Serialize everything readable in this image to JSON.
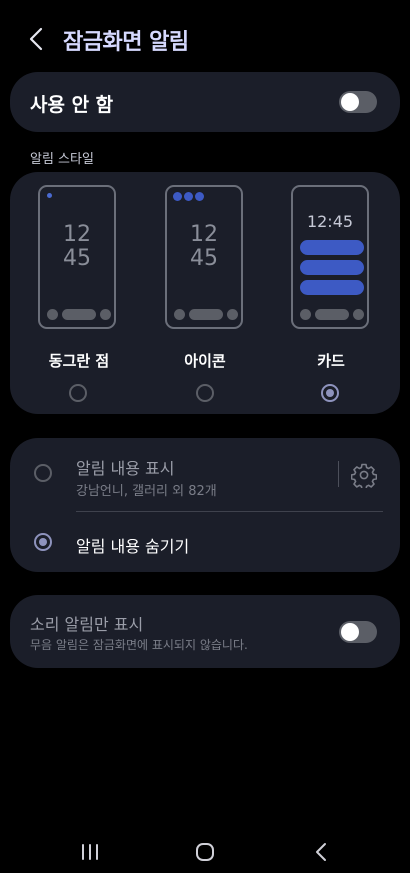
{
  "header": {
    "title": "잠금화면 알림",
    "back_icon": "back-chevron-icon"
  },
  "master_toggle": {
    "label": "사용 안 함",
    "on": false
  },
  "style_section": {
    "label": "알림 스타일",
    "options": [
      {
        "label": "동그란 점",
        "clock": [
          "12",
          "45"
        ],
        "selected": false
      },
      {
        "label": "아이콘",
        "clock": [
          "12",
          "45"
        ],
        "selected": false
      },
      {
        "label": "카드",
        "clock": "12:45",
        "selected": true
      }
    ]
  },
  "visibility": {
    "show": {
      "title": "알림 내용 표시",
      "subtitle": "강남언니, 갤러리 외 82개",
      "selected": false,
      "settings_icon": "gear-icon"
    },
    "hide": {
      "title": "알림 내용 숨기기",
      "selected": true
    }
  },
  "sound_only": {
    "title": "소리 알림만 표시",
    "subtitle": "무음 알림은 잠금화면에 표시되지 않습니다.",
    "on": false
  },
  "colors": {
    "accent": "#8e93bd",
    "card_bg": "#1b1e29",
    "title": "#d6d9ff",
    "card_blue": "#3d5ac4"
  },
  "nav": {
    "recent_icon": "recent-apps-icon",
    "home_icon": "home-icon",
    "back_icon": "back-icon"
  }
}
